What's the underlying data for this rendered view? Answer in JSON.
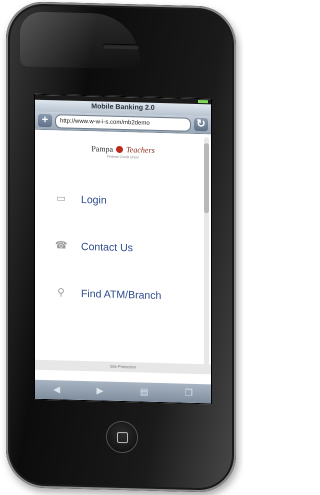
{
  "browser": {
    "title": "Mobile Banking 2.0",
    "url": "http://www.w-w-i-s.com/mb2demo",
    "add_icon": "plus-icon",
    "reload_icon": "reload-icon"
  },
  "logo": {
    "word1": "Pampa",
    "word2": "Teachers",
    "tagline": "Federal Credit Union"
  },
  "menu": {
    "items": [
      {
        "label": "Login",
        "icon": "door-icon"
      },
      {
        "label": "Contact Us",
        "icon": "phone-icon"
      },
      {
        "label": "Find ATM/Branch",
        "icon": "location-pin-icon"
      }
    ]
  },
  "footer": {
    "text": "Site Protection"
  },
  "toolbar": {
    "icons": [
      "back-arrow-icon",
      "forward-arrow-icon",
      "bookmarks-icon",
      "pages-icon"
    ]
  },
  "colors": {
    "link": "#2e4b8c",
    "battery": "#7ed957"
  }
}
